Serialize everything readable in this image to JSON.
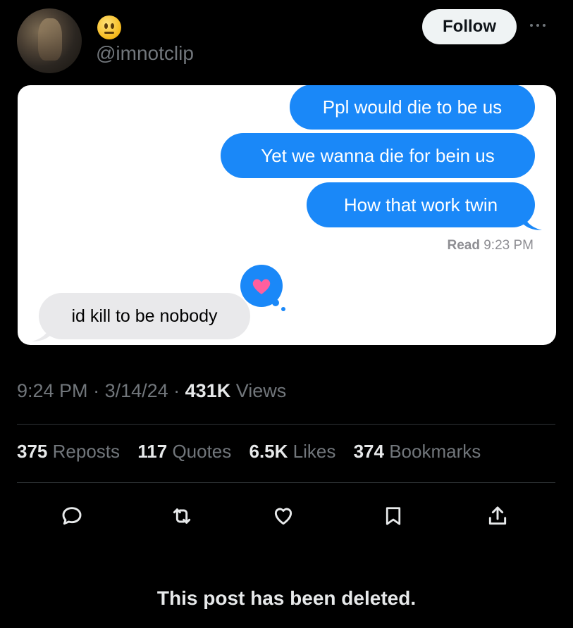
{
  "header": {
    "handle": "@imnotclip",
    "emoji": "neutral-face-emoji",
    "follow_label": "Follow"
  },
  "conversation": {
    "sent": [
      "Ppl would die to be us",
      "Yet we wanna die for bein us",
      "How that work twin"
    ],
    "read_label": "Read",
    "read_time": "9:23 PM",
    "received": "id kill to be nobody",
    "tapback": "heart-icon",
    "colors": {
      "sent_bubble": "#1a88f8",
      "received_bubble": "#e9e9eb",
      "tapback": "#1a88f8",
      "heart": "#ff5f9e"
    }
  },
  "meta": {
    "time": "9:24 PM",
    "date": "3/14/24",
    "views_count": "431K",
    "views_label": "Views"
  },
  "stats": {
    "reposts_count": "375",
    "reposts_label": "Reposts",
    "quotes_count": "117",
    "quotes_label": "Quotes",
    "likes_count": "6.5K",
    "likes_label": "Likes",
    "bookmarks_count": "374",
    "bookmarks_label": "Bookmarks"
  },
  "actions": [
    "reply-icon",
    "repost-icon",
    "like-icon",
    "bookmark-icon",
    "share-icon"
  ],
  "footer": {
    "deleted_text": "This post has been deleted."
  }
}
